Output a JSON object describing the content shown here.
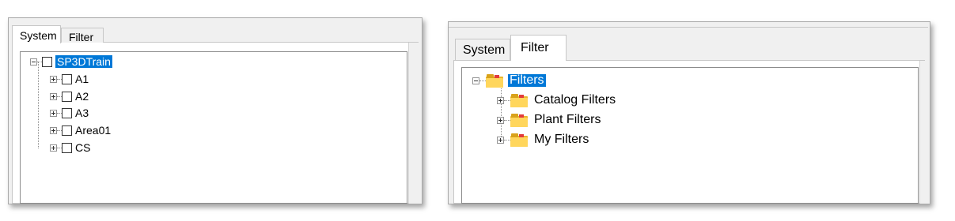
{
  "left_panel": {
    "tabs": [
      {
        "label": "System",
        "active": true
      },
      {
        "label": "Filter",
        "active": false
      }
    ],
    "tree": {
      "root": {
        "label": "SP3DTrain",
        "selected": true,
        "expanded": true,
        "checked": false
      },
      "children": [
        {
          "label": "A1",
          "checked": false,
          "expanded": false
        },
        {
          "label": "A2",
          "checked": false,
          "expanded": false
        },
        {
          "label": "A3",
          "checked": false,
          "expanded": false
        },
        {
          "label": "Area01",
          "checked": false,
          "expanded": false
        },
        {
          "label": "CS",
          "checked": false,
          "expanded": false
        }
      ]
    }
  },
  "right_panel": {
    "tabs": [
      {
        "label": "System",
        "active": false
      },
      {
        "label": "Filter",
        "active": true
      }
    ],
    "tree": {
      "root": {
        "label": "Filters",
        "selected": true,
        "expanded": true,
        "icon": "folder-icon"
      },
      "children": [
        {
          "label": "Catalog Filters",
          "expanded": false,
          "icon": "folder-icon"
        },
        {
          "label": "Plant Filters",
          "expanded": false,
          "icon": "folder-icon"
        },
        {
          "label": "My Filters",
          "expanded": false,
          "icon": "folder-icon"
        }
      ]
    }
  },
  "colors": {
    "selection": "#0078d7",
    "folder": "#ffd65c",
    "panel_bg": "#f0f0f0"
  }
}
